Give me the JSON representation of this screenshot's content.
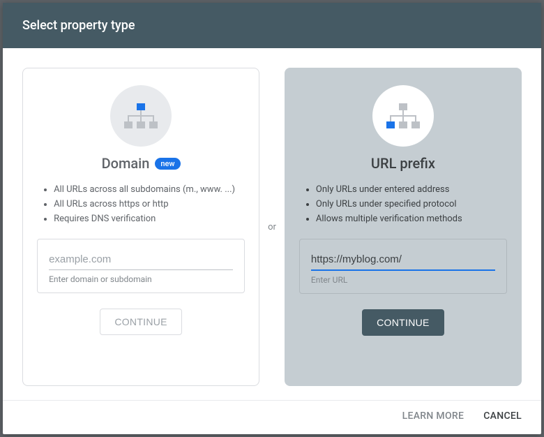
{
  "header": {
    "title": "Select property type"
  },
  "divider": "or",
  "domain_card": {
    "title": "Domain",
    "badge": "new",
    "bullets": [
      "All URLs across all subdomains (m., www. ...)",
      "All URLs across https or http",
      "Requires DNS verification"
    ],
    "input": {
      "placeholder": "example.com",
      "value": "",
      "hint": "Enter domain or subdomain"
    },
    "button": "CONTINUE"
  },
  "url_card": {
    "title": "URL prefix",
    "bullets": [
      "Only URLs under entered address",
      "Only URLs under specified protocol",
      "Allows multiple verification methods"
    ],
    "input": {
      "placeholder": "",
      "value": "https://myblog.com/",
      "hint": "Enter URL"
    },
    "button": "CONTINUE"
  },
  "footer": {
    "learn": "LEARN MORE",
    "cancel": "CANCEL"
  }
}
